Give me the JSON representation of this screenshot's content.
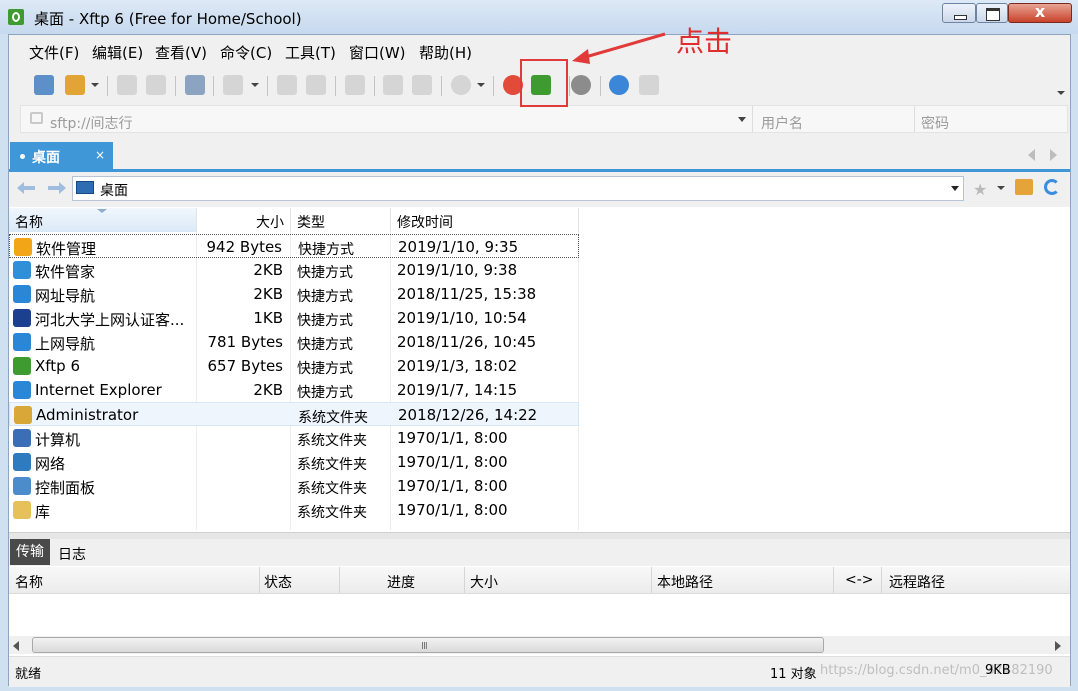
{
  "window": {
    "title": "桌面 - Xftp 6 (Free for Home/School)",
    "close_glyph": "x"
  },
  "menu": [
    "文件(F)",
    "编辑(E)",
    "查看(V)",
    "命令(C)",
    "工具(T)",
    "窗口(W)",
    "帮助(H)"
  ],
  "toolbar": {
    "icons": [
      "new-session-icon",
      "open-folder-icon",
      "connect-icon",
      "disconnect-icon",
      "properties-icon",
      "view-icon",
      "copy-icon",
      "paste-icon",
      "transfer-icon",
      "queue-icon",
      "sync-icon",
      "status-icon",
      "xshell-icon",
      "xftp-green-icon",
      "settings-icon",
      "help-icon",
      "chat-icon"
    ]
  },
  "session_bar": {
    "host_placeholder": "sftp://间志行",
    "username_placeholder": "用户名",
    "password_placeholder": "密码"
  },
  "tab": {
    "label": "桌面",
    "close": "×"
  },
  "path": {
    "current": "桌面"
  },
  "file_list": {
    "columns": {
      "name": "名称",
      "size": "大小",
      "type": "类型",
      "modified": "修改时间"
    },
    "rows": [
      {
        "name": "软件管理",
        "size": "942 Bytes",
        "type": "快捷方式",
        "modified": "2019/1/10, 9:35",
        "icon": "software-manager-icon",
        "color": "#f2a516"
      },
      {
        "name": "软件管家",
        "size": "2KB",
        "type": "快捷方式",
        "modified": "2019/1/10, 9:38",
        "icon": "shortcut-icon",
        "color": "#2f8fd8"
      },
      {
        "name": "网址导航",
        "size": "2KB",
        "type": "快捷方式",
        "modified": "2018/11/25, 15:38",
        "icon": "ie-shortcut-icon",
        "color": "#2a86d6"
      },
      {
        "name": "河北大学上网认证客...",
        "size": "1KB",
        "type": "快捷方式",
        "modified": "2019/1/10, 10:54",
        "icon": "auth-client-icon",
        "color": "#1c3f8f"
      },
      {
        "name": "上网导航",
        "size": "781 Bytes",
        "type": "快捷方式",
        "modified": "2018/11/26, 10:45",
        "icon": "ie-shortcut-icon",
        "color": "#2a86d6"
      },
      {
        "name": "Xftp 6",
        "size": "657 Bytes",
        "type": "快捷方式",
        "modified": "2019/1/3, 18:02",
        "icon": "xftp-shortcut-icon",
        "color": "#3d9b2f"
      },
      {
        "name": "Internet Explorer",
        "size": "2KB",
        "type": "快捷方式",
        "modified": "2019/1/7, 14:15",
        "icon": "ie-shortcut-icon",
        "color": "#2a86d6"
      },
      {
        "name": "Administrator",
        "size": "",
        "type": "系统文件夹",
        "modified": "2018/12/26, 14:22",
        "icon": "user-folder-icon",
        "color": "#d9a638"
      },
      {
        "name": "计算机",
        "size": "",
        "type": "系统文件夹",
        "modified": "1970/1/1, 8:00",
        "icon": "computer-icon",
        "color": "#3a6fb8"
      },
      {
        "name": "网络",
        "size": "",
        "type": "系统文件夹",
        "modified": "1970/1/1, 8:00",
        "icon": "network-icon",
        "color": "#2e7bbf"
      },
      {
        "name": "控制面板",
        "size": "",
        "type": "系统文件夹",
        "modified": "1970/1/1, 8:00",
        "icon": "control-panel-icon",
        "color": "#4c8ccc"
      },
      {
        "name": "库",
        "size": "",
        "type": "系统文件夹",
        "modified": "1970/1/1, 8:00",
        "icon": "library-icon",
        "color": "#e6c15a"
      }
    ]
  },
  "bottom_tabs": {
    "transfer": "传输",
    "log": "日志"
  },
  "transfer_columns": {
    "name": "名称",
    "status": "状态",
    "progress": "进度",
    "size": "大小",
    "local_path": "本地路径",
    "direction": "<->",
    "remote_path": "远程路径"
  },
  "scrollbar_grip": "III",
  "status_bar": {
    "status": "就绪",
    "object_count": "11 对象",
    "total_size": "9KB",
    "watermark": "https://blog.csdn.net/m0_37482190"
  },
  "annotation": {
    "label": "点击",
    "color": "#e03a3a"
  }
}
